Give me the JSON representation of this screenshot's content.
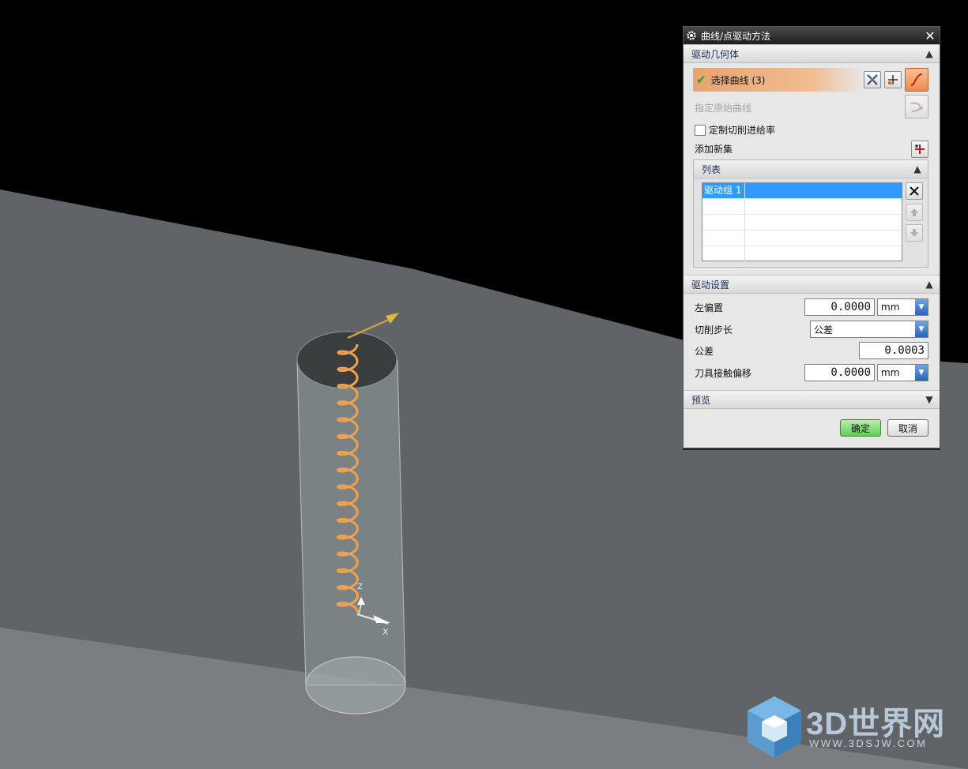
{
  "dialog": {
    "title": "曲线/点驱动方法",
    "sections": {
      "drive_geometry": {
        "header": "驱动几何体",
        "select_curve_label": "选择曲线 (3)",
        "specify_original_curve_label": "指定原始曲线",
        "custom_feedrate_label": "定制切削进给率",
        "custom_feedrate_checked": false,
        "add_new_set_label": "添加新集",
        "list": {
          "header": "列表",
          "rows": [
            "驱动组 1",
            "",
            "",
            "",
            ""
          ]
        }
      },
      "drive_settings": {
        "header": "驱动设置",
        "left_offset_label": "左偏置",
        "left_offset_value": "0.0000",
        "left_offset_unit": "mm",
        "cut_step_label": "切削步长",
        "cut_step_value": "公差",
        "tolerance_label": "公差",
        "tolerance_value": "0.0003",
        "tool_contact_offset_label": "刀具接触偏移",
        "tool_contact_offset_value": "0.0000",
        "tool_contact_offset_unit": "mm"
      },
      "preview": {
        "header": "预览"
      }
    },
    "ok_label": "确定",
    "cancel_label": "取消"
  },
  "viewport": {
    "axis_x_label": "X",
    "axis_z_label": "Z",
    "helix_color": "#f0a050",
    "background_colors": {
      "sky": "#000000",
      "plane_upper": "#606466",
      "plane_lower": "#7a7e80"
    }
  },
  "watermark": {
    "title": "3D世界网",
    "url": "WWW.3DSJW.COM"
  },
  "colors": {
    "selected_row": "#3399ff",
    "ok_button": "#5fcf52",
    "active_curve_button": "#ee8a4c"
  }
}
